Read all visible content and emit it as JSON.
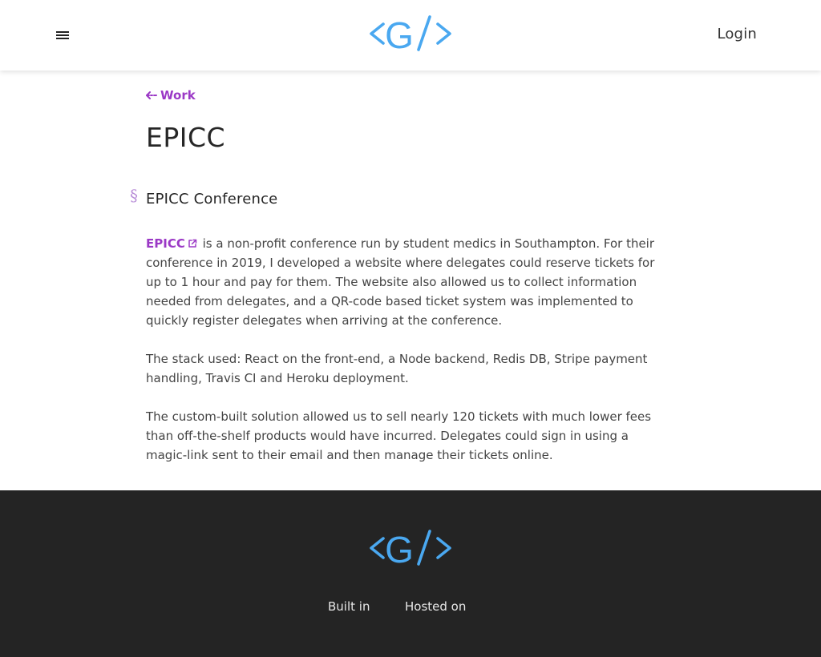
{
  "header": {
    "menu_icon": "hamburger-menu-icon",
    "logo_text": "<G/>",
    "login_label": "Login"
  },
  "main": {
    "back_link_label": "Work",
    "back_icon": "arrow-left-icon",
    "title": "EPICC",
    "section": {
      "anchor_glyph": "§",
      "heading": "EPICC Conference"
    },
    "paragraphs": {
      "p1_link": "EPICC",
      "p1_rest": " is a non-profit conference run by student medics in Southampton. For their conference in 2019, I developed a website where delegates could reserve tickets for up to 1 hour and pay for them. The website also allowed us to collect information needed from delegates, and a QR-code based ticket system was implemented to quickly register delegates when arriving at the conference.",
      "p2": "The stack used: React on the front-end, a Node backend, Redis DB, Stripe payment handling, Travis CI and Heroku deployment.",
      "p3": "The custom-built solution allowed us to sell nearly 120 tickets with much lower fees than off-the-shelf products would have incurred. Delegates could sign in using a magic-link sent to their email and then manage their tickets online."
    }
  },
  "footer": {
    "logo_text": "<G/>",
    "built_in_label": "Built in",
    "hosted_on_label": "Hosted on"
  },
  "colors": {
    "logo_blue": "#4aa8f0",
    "accent_purple": "#9b39c6",
    "footer_bg": "#242424"
  }
}
